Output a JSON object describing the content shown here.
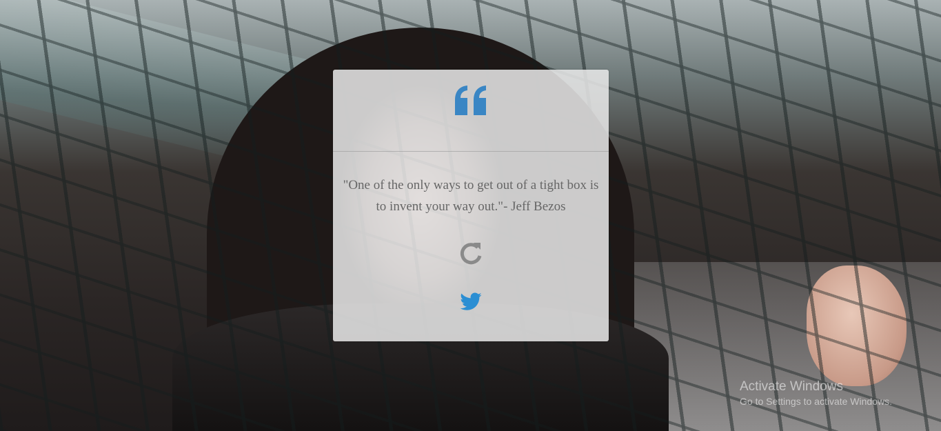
{
  "quote": {
    "text": "\"One of the only ways to get out of a tight box is to invent your way out.\"- Jeff Bezos"
  },
  "icons": {
    "quote": "quote-left-icon",
    "refresh": "refresh-icon",
    "twitter": "twitter-icon"
  },
  "colors": {
    "accent": "#3a86c4",
    "twitter": "#2b8ed3",
    "refresh": "#8a8a8a",
    "card_background": "#e9e9e9",
    "quote_text": "#666666"
  },
  "watermark": {
    "title": "Activate Windows",
    "subtitle": "Go to Settings to activate Windows."
  }
}
